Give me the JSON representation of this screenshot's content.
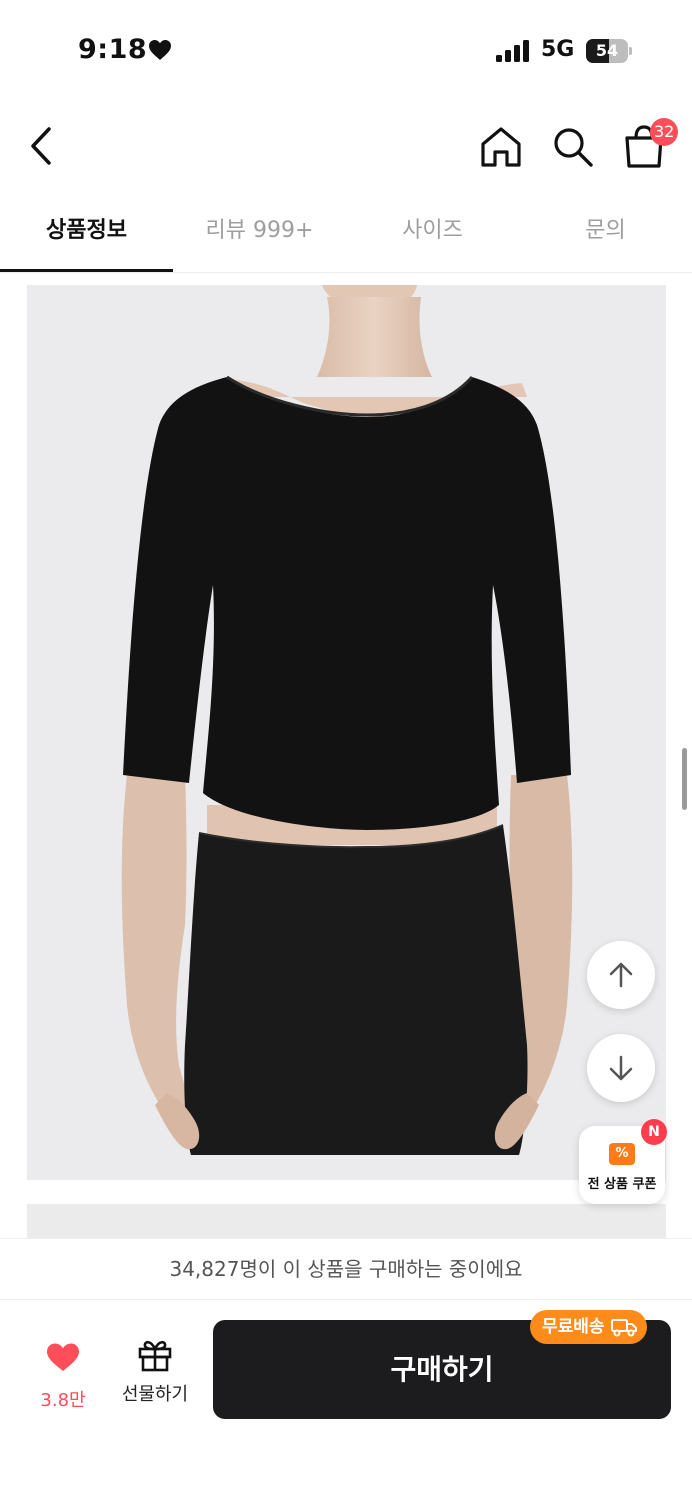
{
  "status_bar": {
    "time": "9:18",
    "network": "5G",
    "battery": "54",
    "battery_level": 0.54
  },
  "header": {
    "cart_count": "32"
  },
  "tabs": [
    {
      "label": "상품정보",
      "active": true
    },
    {
      "label": "리뷰 999+",
      "active": false
    },
    {
      "label": "사이즈",
      "active": false
    },
    {
      "label": "문의",
      "active": false
    }
  ],
  "product": {
    "image_icon": "product-photo"
  },
  "floating": {
    "coupon_label": "전 상품 쿠폰",
    "coupon_icon_text": "%",
    "coupon_badge": "N"
  },
  "bottom": {
    "purchase_notice": "34,827명이 이 상품을 구매하는 중이에요",
    "like_count": "3.8만",
    "gift_label": "선물하기",
    "buy_label": "구매하기",
    "free_shipping_label": "무료배송"
  },
  "colors": {
    "accent": "#ff4d5a",
    "orange": "#ff8c1a",
    "buy_button": "#1c1c1e"
  }
}
